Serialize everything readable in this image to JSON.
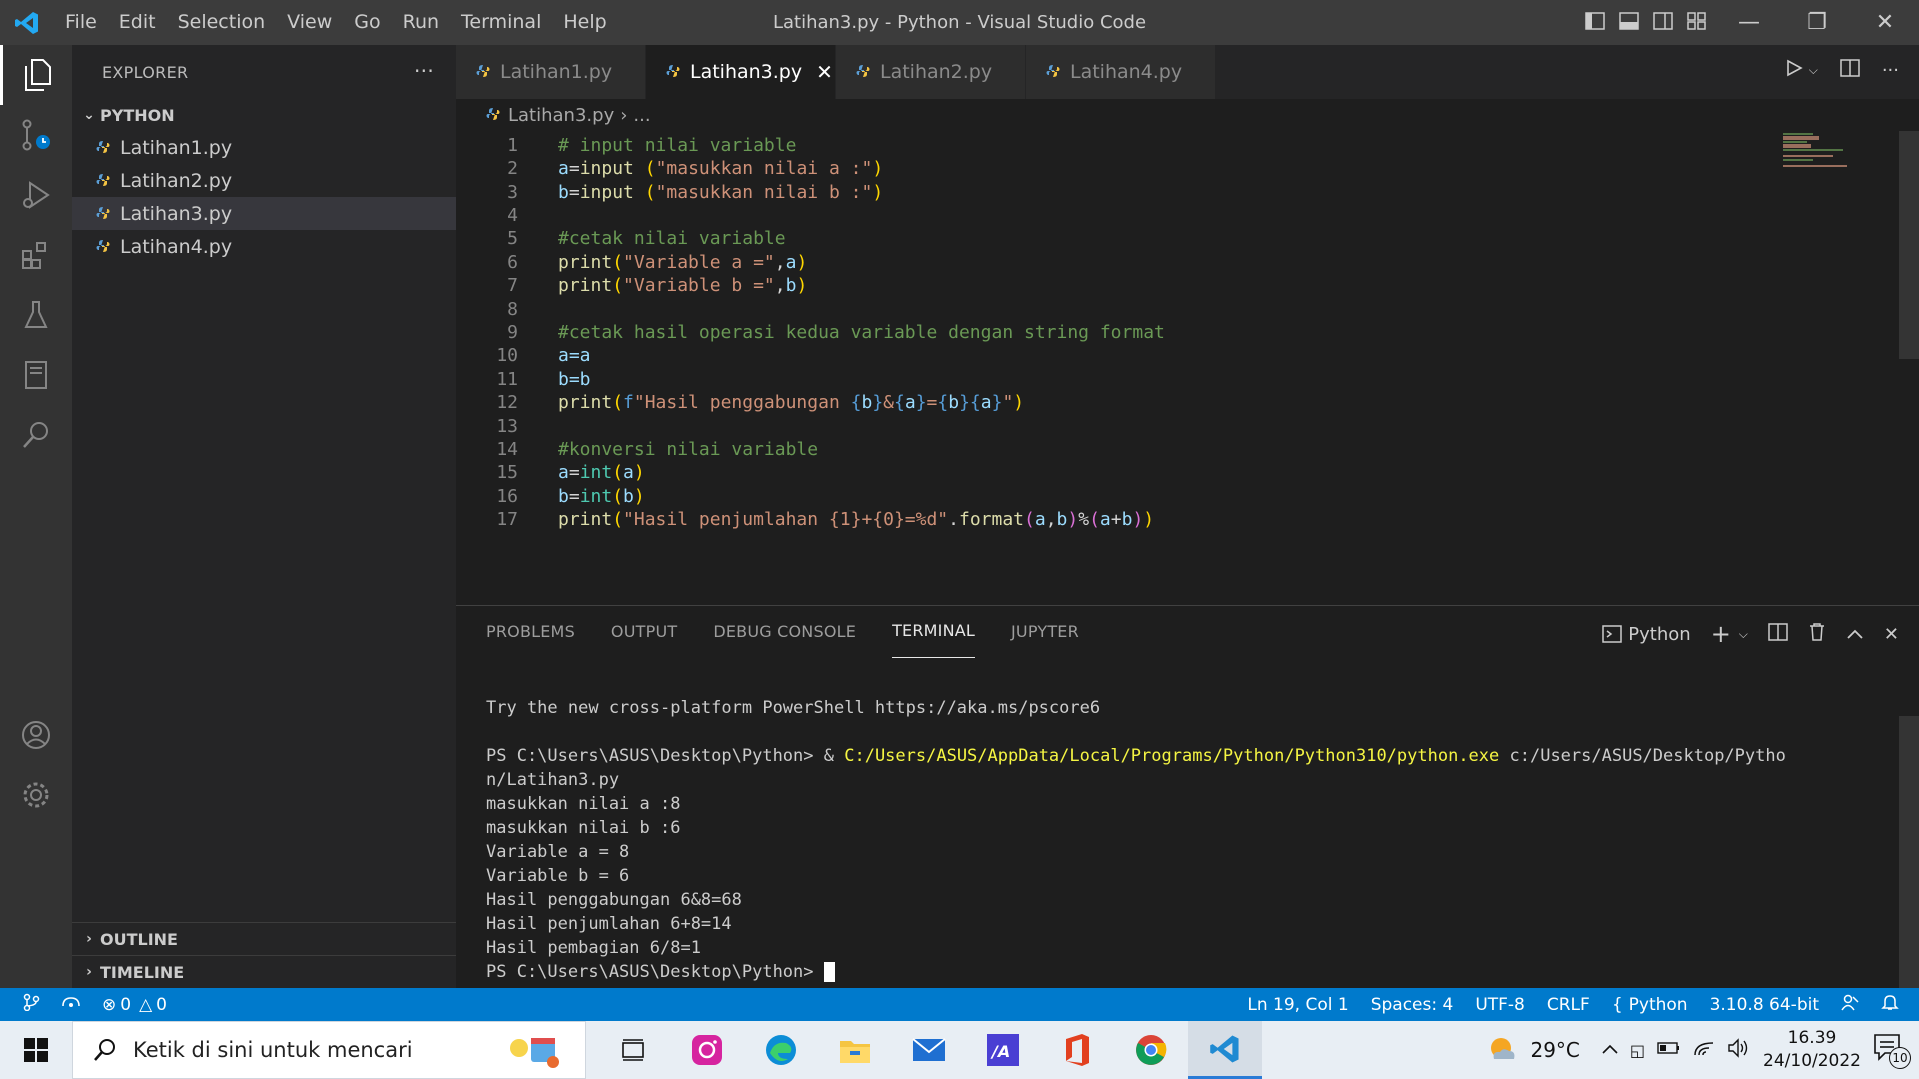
{
  "window": {
    "title": "Latihan3.py - Python - Visual Studio Code",
    "menu": [
      "File",
      "Edit",
      "Selection",
      "View",
      "Go",
      "Run",
      "Terminal",
      "Help"
    ]
  },
  "sidebar": {
    "header": "EXPLORER",
    "more": "···",
    "folder": "PYTHON",
    "files": [
      "Latihan1.py",
      "Latihan2.py",
      "Latihan3.py",
      "Latihan4.py"
    ],
    "selected_file": "Latihan3.py",
    "outline": "OUTLINE",
    "timeline": "TIMELINE"
  },
  "tabs": [
    "Latihan1.py",
    "Latihan3.py",
    "Latihan2.py",
    "Latihan4.py"
  ],
  "active_tab": "Latihan3.py",
  "breadcrumb": {
    "file": "Latihan3.py",
    "rest": "..."
  },
  "editor": {
    "lines": [
      {
        "n": "1",
        "text": "# input nilai variable"
      },
      {
        "n": "2",
        "text": "a=input (\"masukkan nilai a :\")"
      },
      {
        "n": "3",
        "text": "b=input (\"masukkan nilai b :\")"
      },
      {
        "n": "4",
        "text": ""
      },
      {
        "n": "5",
        "text": "#cetak nilai variable"
      },
      {
        "n": "6",
        "text": "print(\"Variable a =\",a)"
      },
      {
        "n": "7",
        "text": "print(\"Variable b =\",b)"
      },
      {
        "n": "8",
        "text": ""
      },
      {
        "n": "9",
        "text": "#cetak hasil operasi kedua variable dengan string format"
      },
      {
        "n": "10",
        "text": "a=a"
      },
      {
        "n": "11",
        "text": "b=b"
      },
      {
        "n": "12",
        "text": "print(f\"Hasil penggabungan {b}&{a}={b}{a}\")"
      },
      {
        "n": "13",
        "text": ""
      },
      {
        "n": "14",
        "text": "#konversi nilai variable"
      },
      {
        "n": "15",
        "text": "a=int(a)"
      },
      {
        "n": "16",
        "text": "b=int(b)"
      },
      {
        "n": "17",
        "text": "print(\"Hasil penjumlahan {1}+{0}=%d\".format(a,b)%(a+b))"
      }
    ]
  },
  "panel": {
    "tabs": [
      "PROBLEMS",
      "OUTPUT",
      "DEBUG CONSOLE",
      "TERMINAL",
      "JUPYTER"
    ],
    "active_tab": "TERMINAL",
    "shell": "Python",
    "terminal": {
      "line1": "Try the new cross-platform PowerShell https://aka.ms/pscore6",
      "prompt_prefix": "PS C:\\Users\\ASUS\\Desktop\\Python> & ",
      "python_path": "C:/Users/ASUS/AppData/Local/Programs/Python/Python310/python.exe",
      "script_arg": " c:/Users/ASUS/Desktop/Pytho",
      "script_arg_cont": "n/Latihan3.py",
      "outputs": [
        "masukkan nilai a :8",
        "masukkan nilai b :6",
        "Variable a = 8",
        "Variable b = 6",
        "Hasil penggabungan 6&8=68",
        "Hasil penjumlahan 6+8=14",
        "Hasil pembagian 6/8=1"
      ],
      "final_prompt": "PS C:\\Users\\ASUS\\Desktop\\Python> "
    }
  },
  "statusbar": {
    "errors": "0",
    "warnings": "0",
    "position": "Ln 19, Col 1",
    "spaces": "Spaces: 4",
    "encoding": "UTF-8",
    "eol": "CRLF",
    "language": "Python",
    "interpreter": "3.10.8 64-bit"
  },
  "taskbar": {
    "search_placeholder": "Ketik di sini untuk mencari",
    "temperature": "29°C",
    "time": "16.39",
    "date": "24/10/2022",
    "notifications": "10"
  },
  "colors": {
    "accent": "#007acc",
    "titlebar": "#3c3c3c",
    "activitybar": "#333333",
    "sidebar": "#252526",
    "editor": "#1e1e1e"
  }
}
